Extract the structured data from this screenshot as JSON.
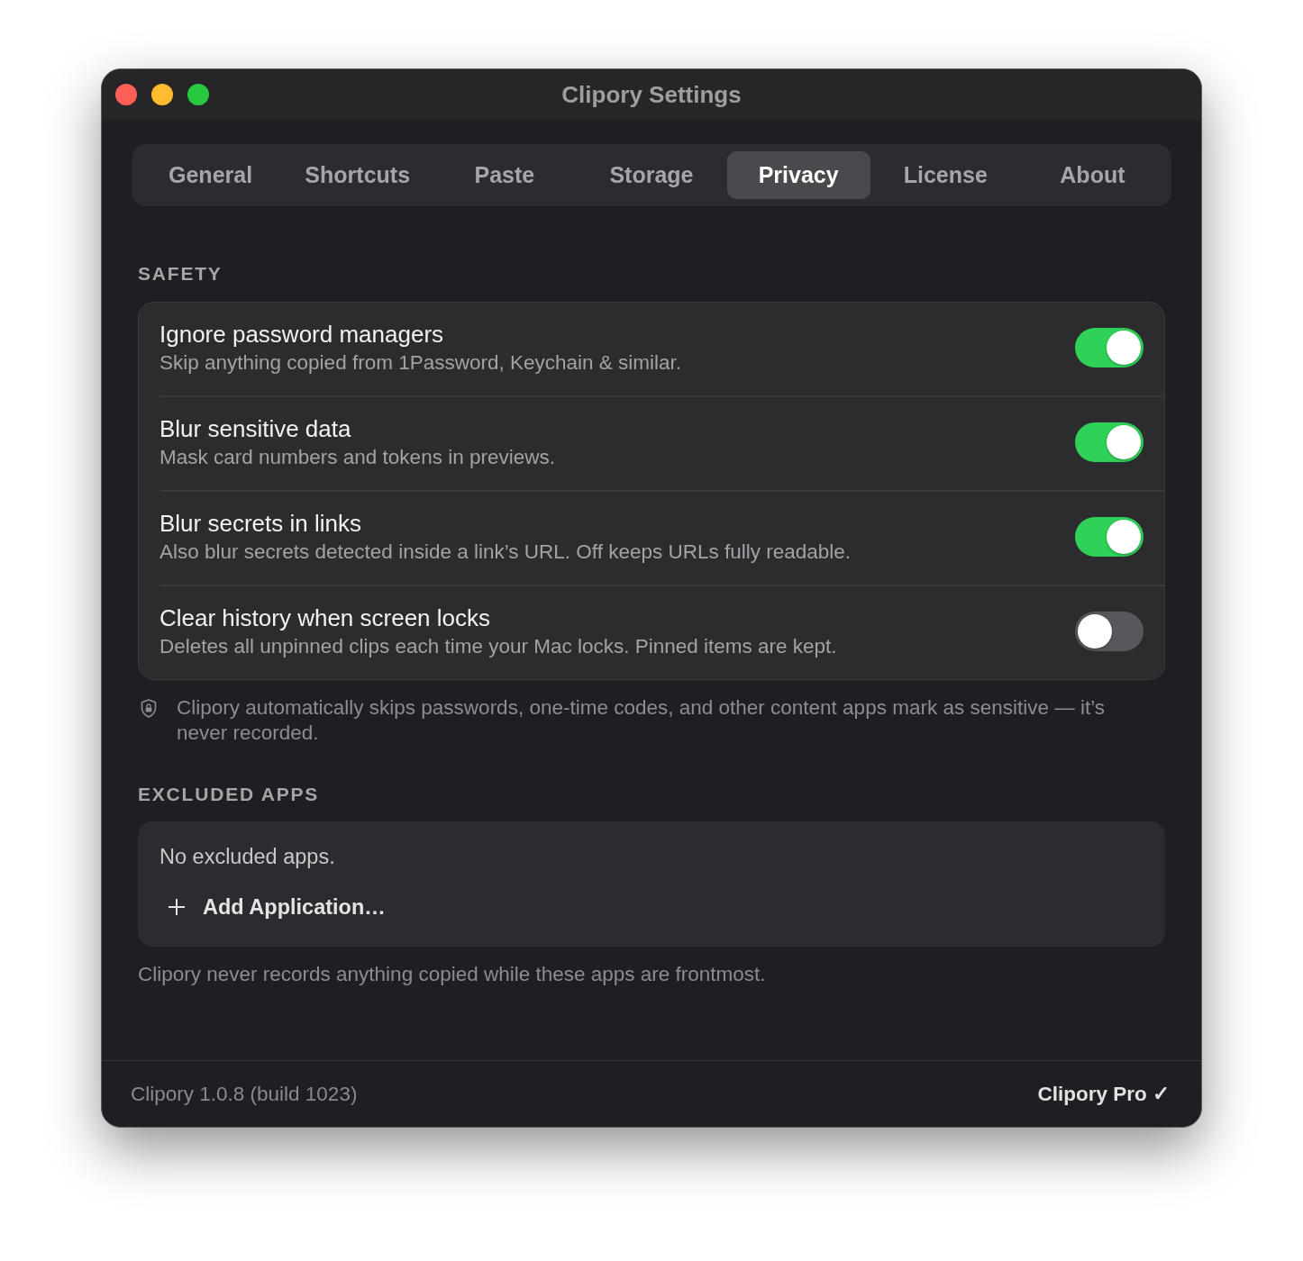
{
  "window": {
    "title": "Clipory Settings"
  },
  "tabs": [
    {
      "label": "General",
      "selected": false
    },
    {
      "label": "Shortcuts",
      "selected": false
    },
    {
      "label": "Paste",
      "selected": false
    },
    {
      "label": "Storage",
      "selected": false
    },
    {
      "label": "Privacy",
      "selected": true
    },
    {
      "label": "License",
      "selected": false
    },
    {
      "label": "About",
      "selected": false
    }
  ],
  "safety": {
    "heading": "SAFETY",
    "settings": [
      {
        "title": "Ignore password managers",
        "description": "Skip anything copied from 1Password, Keychain & similar.",
        "on": true
      },
      {
        "title": "Blur sensitive data",
        "description": "Mask card numbers and tokens in previews.",
        "on": true
      },
      {
        "title": "Blur secrets in links",
        "description": "Also blur secrets detected inside a link’s URL. Off keeps URLs fully readable.",
        "on": true
      },
      {
        "title": "Clear history when screen locks",
        "description": "Deletes all unpinned clips each time your Mac locks. Pinned items are kept.",
        "on": false
      }
    ],
    "note": "Clipory automatically skips passwords, one-time codes, and other content apps mark as sensitive — it’s never recorded."
  },
  "excluded_apps": {
    "heading": "EXCLUDED APPS",
    "empty_message": "No excluded apps.",
    "add_button": "Add Application…",
    "note": "Clipory never records anything copied while these apps are frontmost."
  },
  "status_bar": {
    "version": "Clipory 1.0.8 (build 1023)",
    "license": "Clipory Pro ✓"
  }
}
